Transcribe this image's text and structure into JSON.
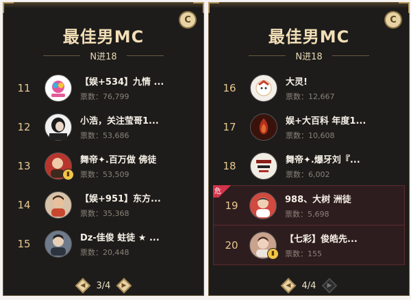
{
  "left": {
    "title": "最佳男MC",
    "subtitle": "N进18",
    "badge": "C",
    "page": "3/4",
    "rows": [
      {
        "rank": "11",
        "name": "【娱+534】九情 ...",
        "votes": "票数：76,799",
        "avatar_color": "#e45a9a"
      },
      {
        "rank": "12",
        "name": "小浩，关注莹哥1...",
        "votes": "票数：53,686",
        "avatar_color": "#222222"
      },
      {
        "rank": "13",
        "name": "舞帝✦.百万做 佛徒",
        "votes": "票数：53,509",
        "avatar_color": "#c2473a"
      },
      {
        "rank": "14",
        "name": "【娱+951】东方...",
        "votes": "票数：35,368",
        "avatar_color": "#b58a6a"
      },
      {
        "rank": "15",
        "name": "Dz-佳俊 蛀徒 ★ ...",
        "votes": "票数：20,448",
        "avatar_color": "#7d8a99"
      }
    ]
  },
  "right": {
    "title": "最佳男MC",
    "subtitle": "N进18",
    "badge": "C",
    "page": "4/4",
    "danger_label": "危",
    "rows": [
      {
        "rank": "16",
        "name": "大灵!",
        "votes": "票数：12,667",
        "avatar_color": "#e6e0d6"
      },
      {
        "rank": "17",
        "name": "娱+大百科 年度1...",
        "votes": "票数：10,608",
        "avatar_color": "#8a2a1d"
      },
      {
        "rank": "18",
        "name": "舞帝✦.爆牙刘『...",
        "votes": "票数：6,002",
        "avatar_color": "#d9d1c4"
      },
      {
        "rank": "19",
        "name": "988、大树 洲徒",
        "votes": "票数：5,698",
        "avatar_color": "#c94f4a"
      },
      {
        "rank": "20",
        "name": "【七彩】俊皓先...",
        "votes": "票数：155",
        "avatar_color": "#b68c76"
      }
    ]
  },
  "colors": {
    "panel_bg": "#1d1c1b",
    "gold": "#e9c98f",
    "highlight_bg": "#2e1d1f"
  }
}
